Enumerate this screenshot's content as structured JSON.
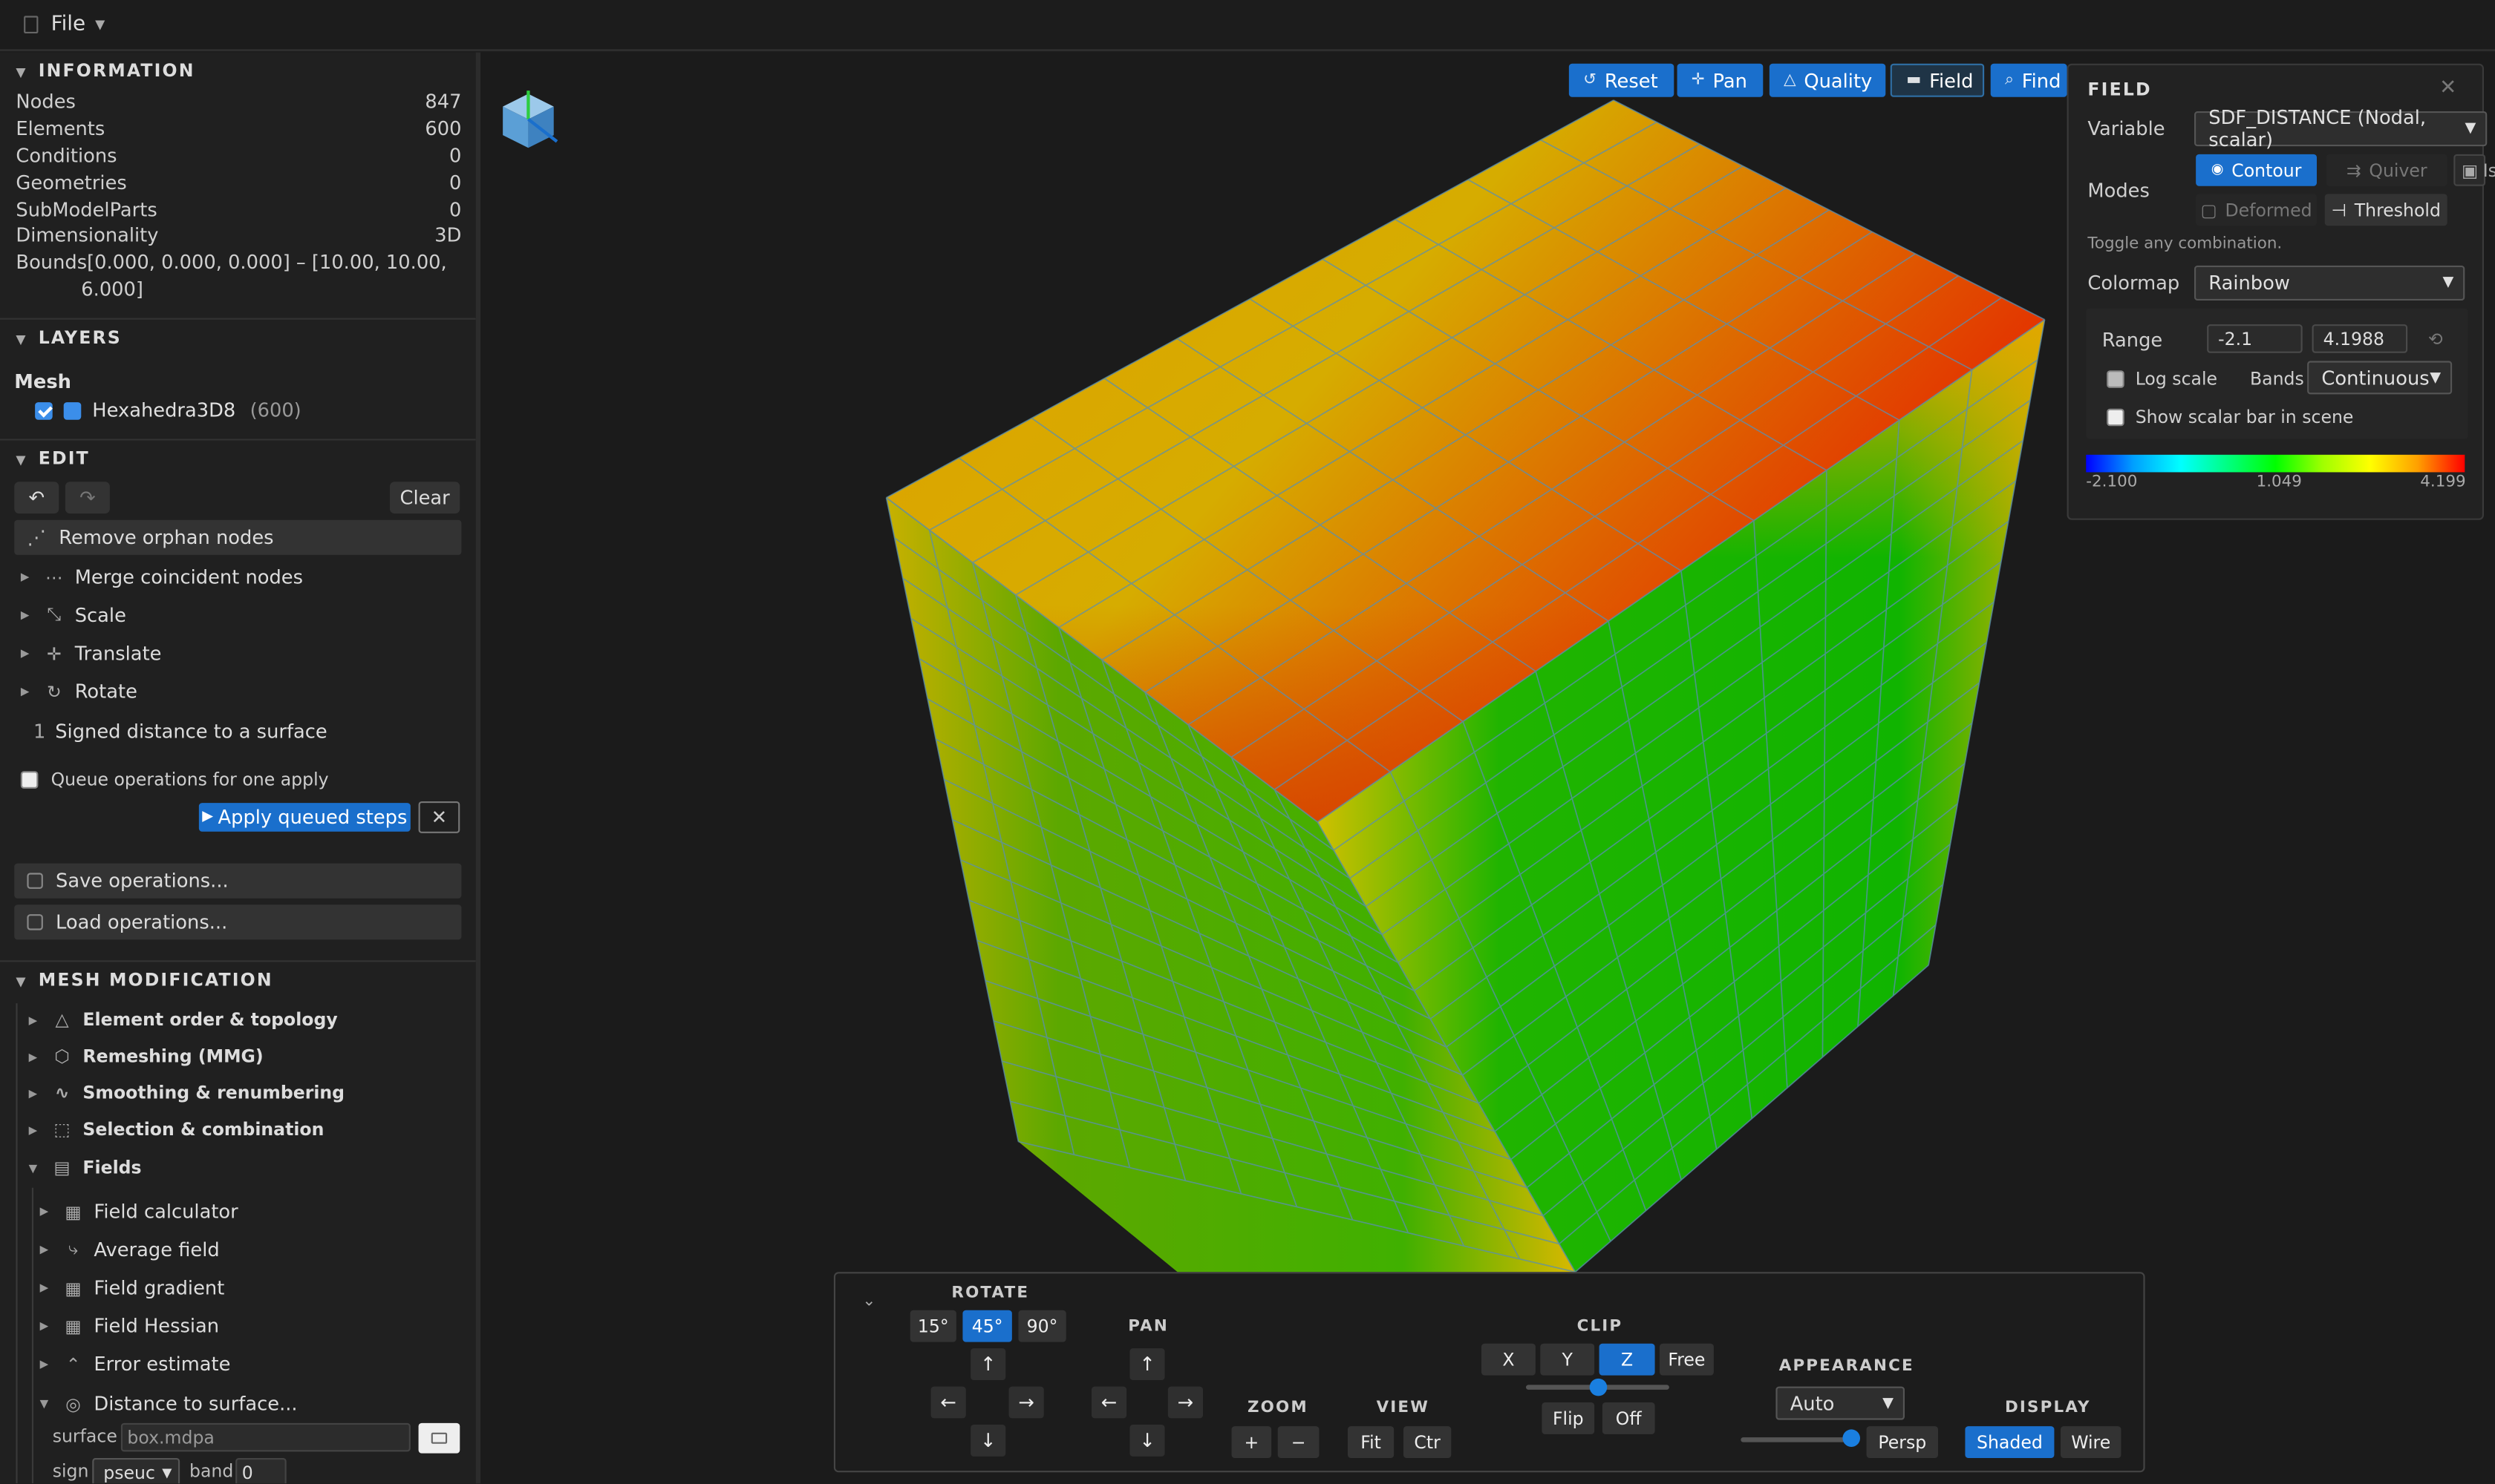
{
  "menubar": {
    "file_label": "File"
  },
  "information": {
    "title": "INFORMATION",
    "rows": [
      {
        "k": "Nodes",
        "v": "847"
      },
      {
        "k": "Elements",
        "v": "600"
      },
      {
        "k": "Conditions",
        "v": "0"
      },
      {
        "k": "Geometries",
        "v": "0"
      },
      {
        "k": "SubModelParts",
        "v": "0"
      },
      {
        "k": "Dimensionality",
        "v": "3D"
      }
    ],
    "bounds_label": "Bounds",
    "bounds_value": "[0.000, 0.000, 0.000] – [10.00, 10.00,",
    "bounds_value2": "6.000]"
  },
  "layers": {
    "title": "LAYERS",
    "group": "Mesh",
    "item_label": "Hexahedra3D8",
    "item_count": "(600)"
  },
  "edit": {
    "title": "EDIT",
    "clear_label": "Clear",
    "remove_orphan": "Remove orphan nodes",
    "items": [
      "Merge coincident nodes",
      "Scale",
      "Translate",
      "Rotate"
    ],
    "queued_index": "1",
    "queued_step": "Signed distance to a surface",
    "queue_label": "Queue operations for one apply",
    "apply_label": "Apply queued steps",
    "save_label": "Save operations...",
    "load_label": "Load operations..."
  },
  "mesh_modification": {
    "title": "MESH MODIFICATION",
    "groups": [
      "Element order & topology",
      "Remeshing (MMG)",
      "Smoothing & renumbering",
      "Selection & combination",
      "Fields"
    ],
    "field_items": [
      "Field calculator",
      "Average field",
      "Field gradient",
      "Field Hessian",
      "Error estimate",
      "Distance to surface..."
    ],
    "surface_label": "surface",
    "surface_value": "box.mdpa",
    "sign_label": "sign",
    "sign_value": "pseuc",
    "band_label": "band",
    "band_value": "0"
  },
  "toolbar": {
    "reset": "Reset",
    "pan": "Pan",
    "quality": "Quality",
    "field": "Field",
    "find": "Find"
  },
  "field_panel": {
    "title": "FIELD",
    "variable_label": "Variable",
    "variable_value": "SDF_DISTANCE (Nodal, scalar)",
    "modes_label": "Modes",
    "mode_contour": "Contour",
    "mode_quiver": "Quiver",
    "mode_iso": "Is",
    "mode_deformed": "Deformed",
    "mode_threshold": "Threshold",
    "toggle_hint": "Toggle any combination.",
    "colormap_label": "Colormap",
    "colormap_value": "Rainbow",
    "range_label": "Range",
    "range_min": "-2.1",
    "range_max": "4.1988",
    "log_label": "Log scale",
    "bands_label": "Bands",
    "bands_value": "Continuous",
    "scalarbar_label": "Show scalar bar in scene",
    "bar_min": "-2.100",
    "bar_mid": "1.049",
    "bar_max": "4.199"
  },
  "bottom": {
    "rotate_label": "ROTATE",
    "angles": [
      "15°",
      "45°",
      "90°"
    ],
    "pan_label": "PAN",
    "zoom_label": "ZOOM",
    "view_label": "VIEW",
    "fit": "Fit",
    "ctr": "Ctr",
    "clip_label": "CLIP",
    "clip_axes": [
      "X",
      "Y",
      "Z",
      "Free"
    ],
    "flip": "Flip",
    "off": "Off",
    "appearance_label": "APPEARANCE",
    "appearance_value": "Auto",
    "persp": "Persp",
    "display_label": "DISPLAY",
    "shaded": "Shaded",
    "wire": "Wire",
    "up": "↑",
    "down": "↓",
    "left": "←",
    "right": "→",
    "plus": "+",
    "minus": "−"
  },
  "colors": {
    "accent": "#1a6fcc",
    "bg": "#1e1e1e",
    "panel": "#202020"
  }
}
